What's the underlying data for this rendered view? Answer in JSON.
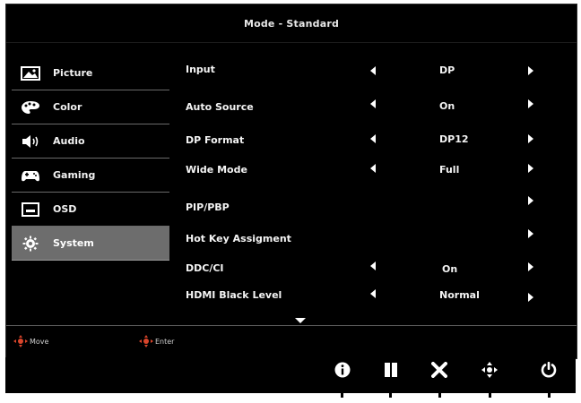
{
  "window": {
    "title": "Mode - Standard"
  },
  "sidebar": {
    "items": [
      {
        "label": "Picture",
        "icon": "picture-icon",
        "active": false
      },
      {
        "label": "Color",
        "icon": "palette-icon",
        "active": false
      },
      {
        "label": "Audio",
        "icon": "speaker-icon",
        "active": false
      },
      {
        "label": "Gaming",
        "icon": "gamepad-icon",
        "active": false
      },
      {
        "label": "OSD",
        "icon": "osd-icon",
        "active": false
      },
      {
        "label": "System",
        "icon": "gear-icon",
        "active": true
      }
    ]
  },
  "settings": {
    "rows": [
      {
        "label": "Input",
        "value": "DP",
        "has_left": true,
        "has_right": true
      },
      {
        "label": "Auto Source",
        "value": "On",
        "has_left": true,
        "has_right": true
      },
      {
        "label": "DP Format",
        "value": "DP12",
        "has_left": true,
        "has_right": true
      },
      {
        "label": "Wide Mode",
        "value": "Full",
        "has_left": true,
        "has_right": true
      },
      {
        "label": "PIP/PBP",
        "value": "",
        "has_left": false,
        "has_right": true
      },
      {
        "label": "Hot Key Assigment",
        "value": "",
        "has_left": false,
        "has_right": true
      },
      {
        "label": "DDC/CI",
        "value": "On",
        "has_left": true,
        "has_right": true
      },
      {
        "label": "HDMI Black Level",
        "value": "Normal",
        "has_left": true,
        "has_right": true
      }
    ],
    "more_indicator": "down-arrow-icon"
  },
  "hints": {
    "move_label": "Move",
    "enter_label": "Enter",
    "move_icon": "dpad-icon",
    "enter_icon": "dpad-icon"
  },
  "buttons": [
    {
      "icon": "info-icon",
      "glyph": "i"
    },
    {
      "icon": "pause-icon",
      "glyph": "❚❚"
    },
    {
      "icon": "close-icon",
      "glyph": "✖"
    },
    {
      "icon": "navigate-icon",
      "glyph": "✥"
    },
    {
      "icon": "power-icon",
      "glyph": "⏻"
    }
  ],
  "colors": {
    "background": "#000000",
    "active_item": "#6d6d6d",
    "accent_dpad": "#d9452b",
    "text": "#ffffff"
  }
}
